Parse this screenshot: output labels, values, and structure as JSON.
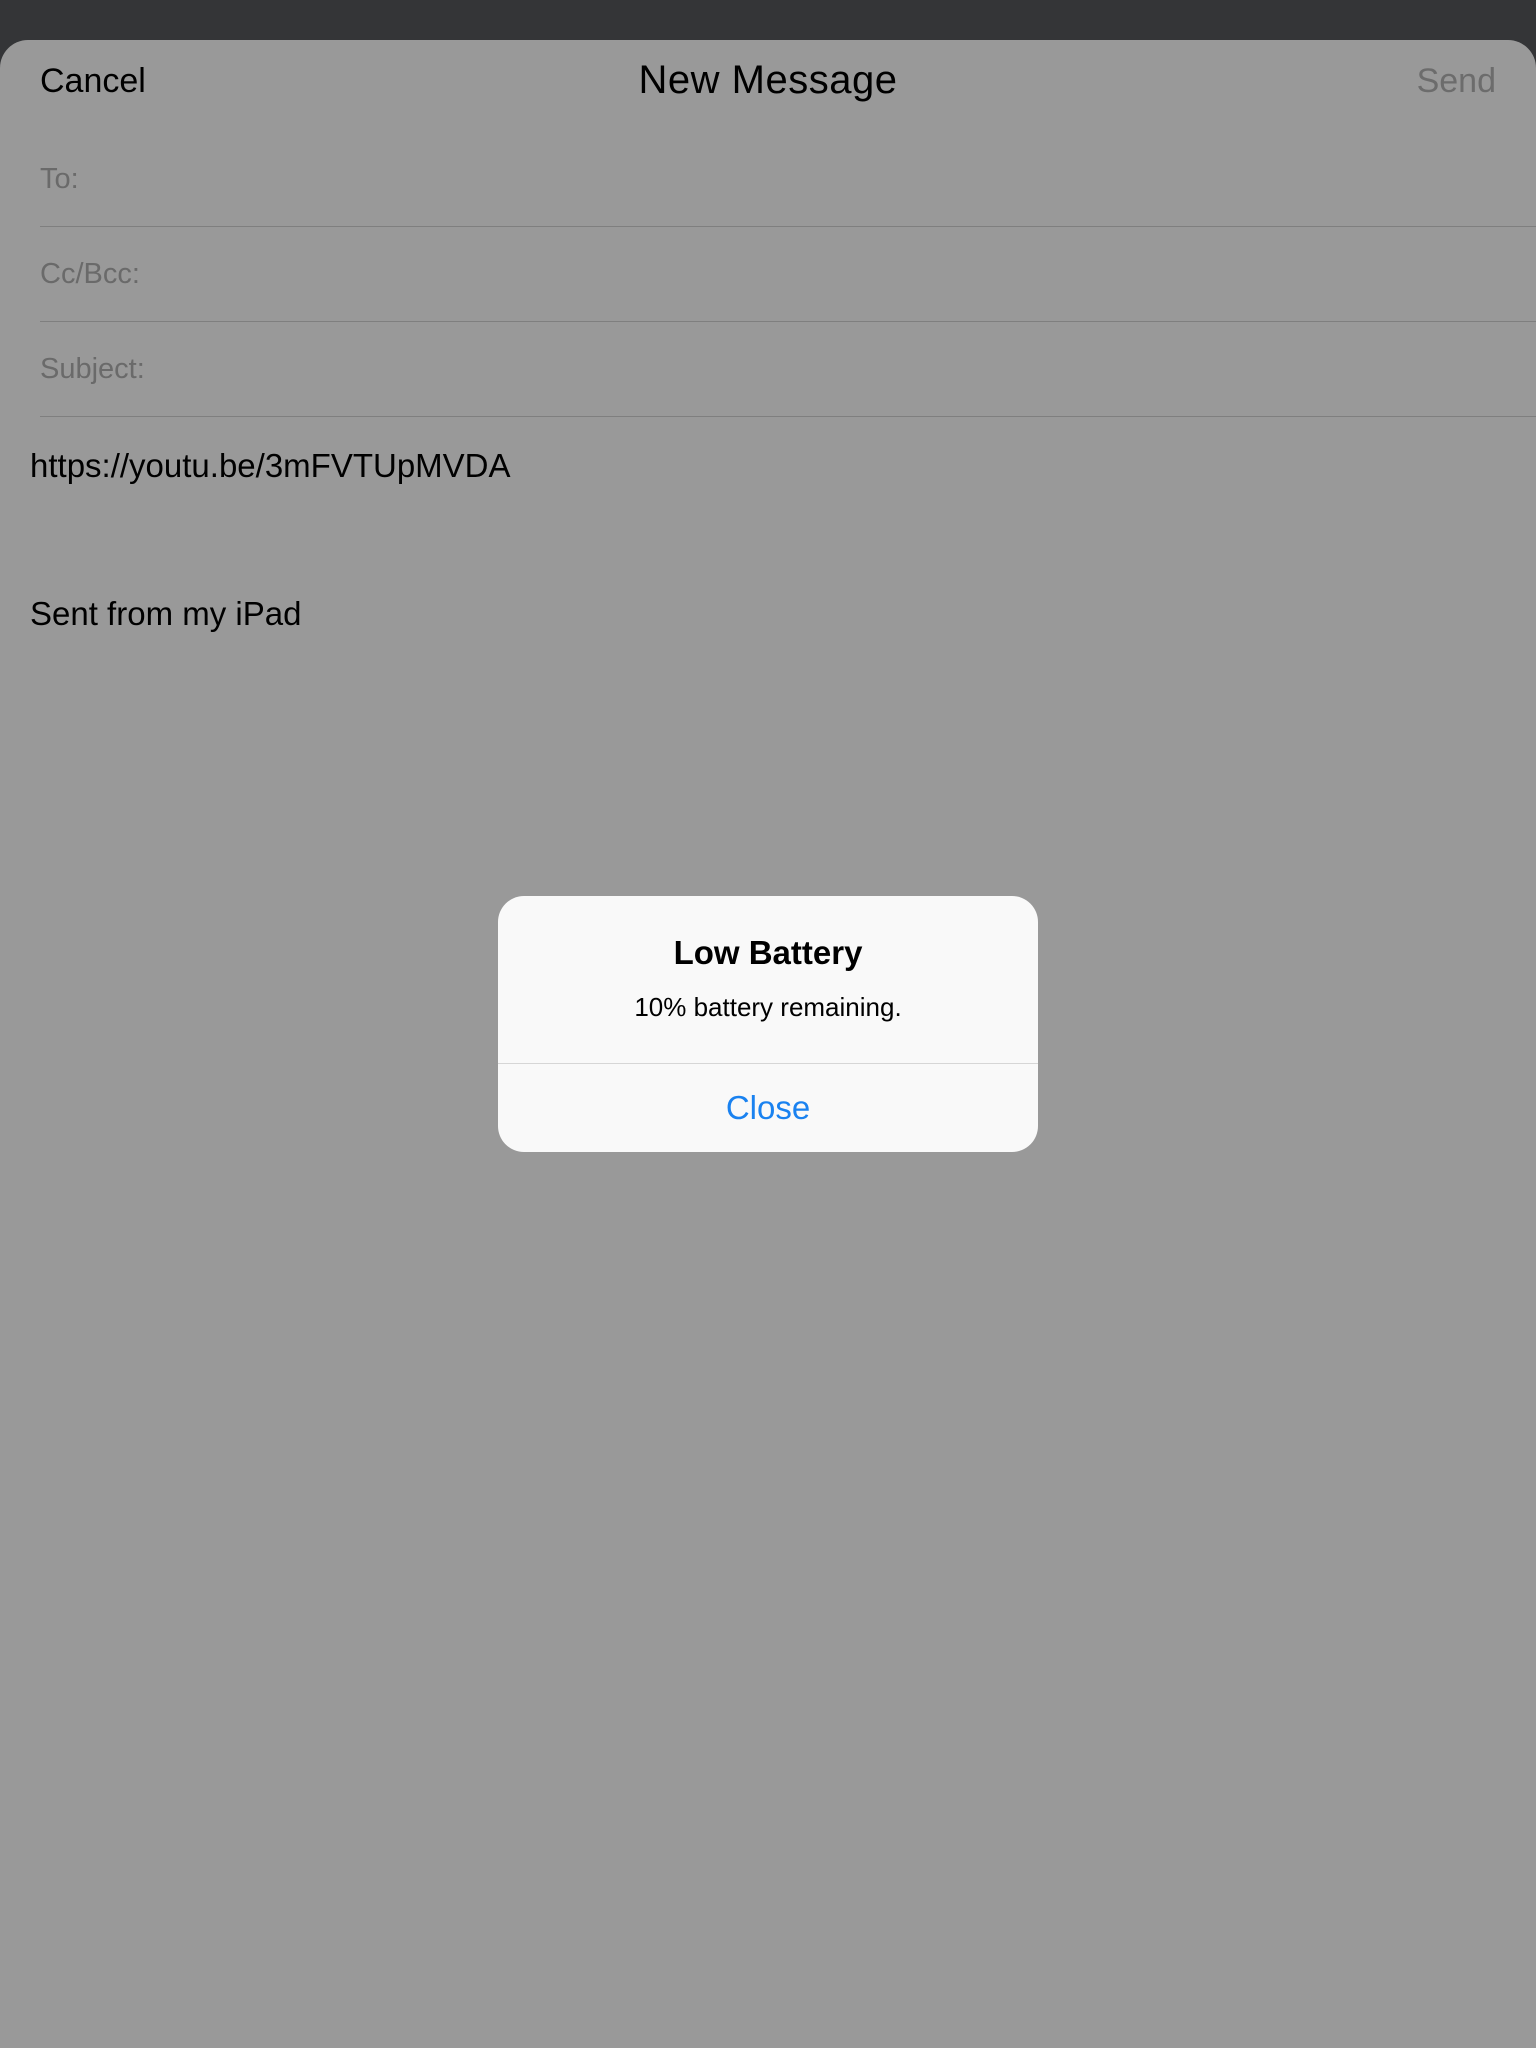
{
  "nav": {
    "cancel_label": "Cancel",
    "title": "New Message",
    "send_label": "Send"
  },
  "fields": {
    "to_label": "To:",
    "ccbcc_label": "Cc/Bcc:",
    "subject_label": "Subject:"
  },
  "body": {
    "link": "https://youtu.be/3mFVTUpMVDA",
    "signature": "Sent from my iPad"
  },
  "alert": {
    "title": "Low Battery",
    "message": "10% battery remaining.",
    "close_label": "Close"
  },
  "colors": {
    "accent": "#1a82f0",
    "dimmed_background": "#999999",
    "alert_background": "#f9f9f9"
  }
}
